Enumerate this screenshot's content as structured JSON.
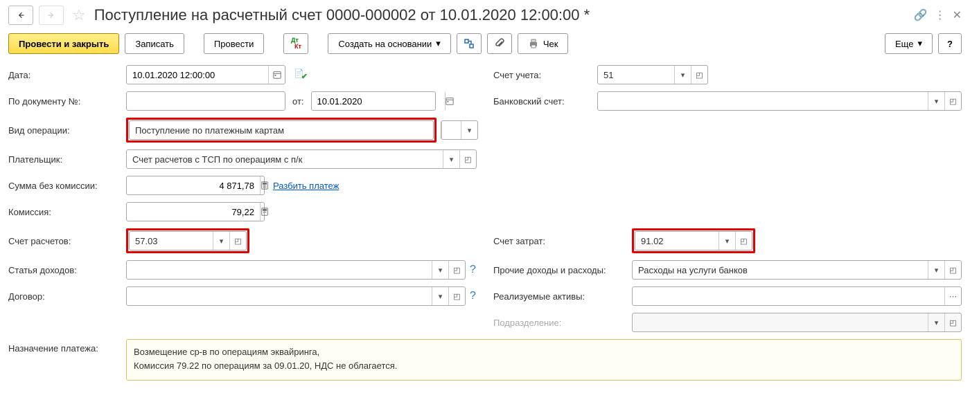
{
  "title": "Поступление на расчетный счет 0000-000002 от 10.01.2020 12:00:00 *",
  "toolbar": {
    "submit_close": "Провести и закрыть",
    "save": "Записать",
    "submit": "Провести",
    "create_based": "Создать на основании",
    "check": "Чек",
    "more": "Еще",
    "help": "?"
  },
  "labels": {
    "date": "Дата:",
    "doc_no": "По документу №:",
    "from": "от:",
    "op_type": "Вид операции:",
    "payer": "Плательщик:",
    "sum_no_fee": "Сумма без комиссии:",
    "fee": "Комиссия:",
    "acc_calc": "Счет расчетов:",
    "income_item": "Статья доходов:",
    "contract": "Договор:",
    "purpose": "Назначение платежа:",
    "account": "Счет учета:",
    "bank_acc": "Банковский счет:",
    "cost_acc": "Счет затрат:",
    "other_ie": "Прочие доходы и расходы:",
    "assets": "Реализуемые активы:",
    "subdiv": "Подразделение:",
    "split_payment": "Разбить платеж"
  },
  "values": {
    "date": "10.01.2020 12:00:00",
    "doc_no": "",
    "from_date": "10.01.2020",
    "op_type": "Поступление по платежным картам",
    "payer": "Счет расчетов с ТСП по операциям с п/к",
    "sum_no_fee": "4 871,78",
    "fee": "79,22",
    "acc_calc": "57.03",
    "income_item": "",
    "contract": "",
    "account": "51",
    "bank_acc": "",
    "cost_acc": "91.02",
    "other_ie": "Расходы на услуги банков",
    "assets": "",
    "subdiv": "",
    "purpose_l1": "Возмещение ср-в по операциям эквайринга,",
    "purpose_l2": "Комиссия 79.22 по операциям за 09.01.20, НДС не облагается."
  }
}
